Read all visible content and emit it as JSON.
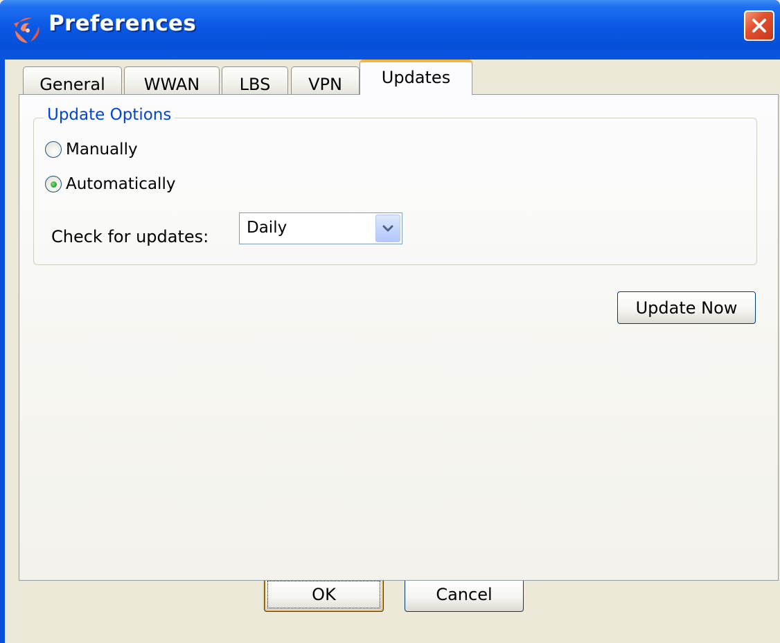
{
  "window": {
    "title": "Preferences"
  },
  "tabs": [
    {
      "label": "General",
      "selected": false
    },
    {
      "label": "WWAN",
      "selected": false
    },
    {
      "label": "LBS",
      "selected": false
    },
    {
      "label": "VPN",
      "selected": false
    },
    {
      "label": "Updates",
      "selected": true
    }
  ],
  "update_options": {
    "group_label": "Update Options",
    "manual_label": "Manually",
    "automatic_label": "Automatically",
    "selected": "Automatically",
    "check_label": "Check for updates:",
    "frequency_value": "Daily"
  },
  "actions": {
    "update_now_label": "Update Now",
    "ok_label": "OK",
    "cancel_label": "Cancel"
  },
  "colors": {
    "titlebar": "#0a58e4",
    "selected_tab_accent": "#f8b33a",
    "group_label": "#0046d5",
    "close_button": "#e2512f"
  }
}
